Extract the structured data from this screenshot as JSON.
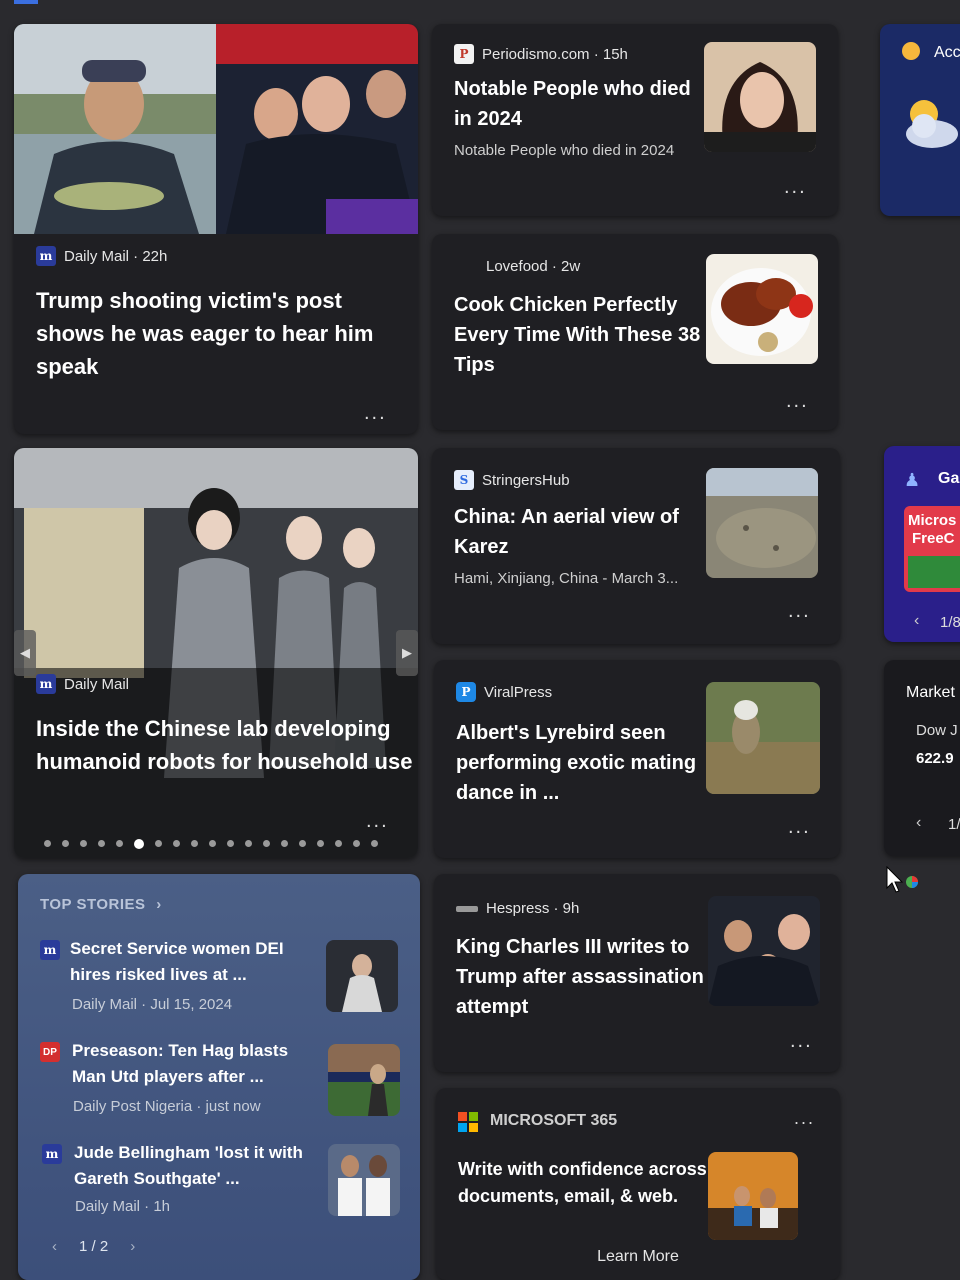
{
  "top_strip_color": "#3b6fe0",
  "hero1": {
    "source": "Daily Mail · 22h",
    "title": "Trump shooting victim's post shows he was eager to hear him speak",
    "more": "..."
  },
  "card_periodismo": {
    "source": "Periodismo.com · 15h",
    "title": "Notable People who died in 2024",
    "desc": "Notable People who died in 2024",
    "more": "..."
  },
  "card_lovefood": {
    "source": "Lovefood · 2w",
    "title": "Cook Chicken Perfectly Every Time With These 38 Tips",
    "more": "..."
  },
  "weather": {
    "label": "Acc"
  },
  "hero2": {
    "source": "Daily Mail",
    "title": "Inside the Chinese lab developing humanoid robots for household use",
    "more": "...",
    "carousel_total": 19,
    "carousel_active": 6
  },
  "card_stringers": {
    "source": "StringersHub",
    "title": "China: An aerial view of Karez",
    "desc": "Hami, Xinjiang, China - March 3...",
    "more": "..."
  },
  "card_viralpress": {
    "source": "ViralPress",
    "title": "Albert's Lyrebird seen performing exotic mating dance in ...",
    "more": "..."
  },
  "games": {
    "label": "Ga",
    "promo_line1": "Micros",
    "promo_line2": "FreeC",
    "pager": "1/8"
  },
  "market": {
    "title": "Market",
    "index": "Dow J",
    "value": "622.9",
    "pager": "1/"
  },
  "top_stories": {
    "header": "TOP STORIES",
    "chevron": "›",
    "items": [
      {
        "icon": "m",
        "title": "Secret Service women DEI hires risked lives at ...",
        "meta": "Daily Mail · Jul 15, 2024"
      },
      {
        "icon": "DP",
        "title": "Preseason: Ten Hag blasts Man Utd players after ...",
        "meta": "Daily Post Nigeria · just now"
      },
      {
        "icon": "m",
        "title": "Jude Bellingham 'lost it with Gareth Southgate' ...",
        "meta": "Daily Mail · 1h"
      }
    ],
    "pager": "1 / 2",
    "prev": "‹",
    "next": "›"
  },
  "card_hespress": {
    "source": "Hespress · 9h",
    "title": "King Charles III writes to Trump after assassination attempt",
    "more": "..."
  },
  "ms365": {
    "header": "MICROSOFT 365",
    "body": "Write with confidence across documents, email, & web.",
    "cta": "Learn More",
    "more": "..."
  }
}
